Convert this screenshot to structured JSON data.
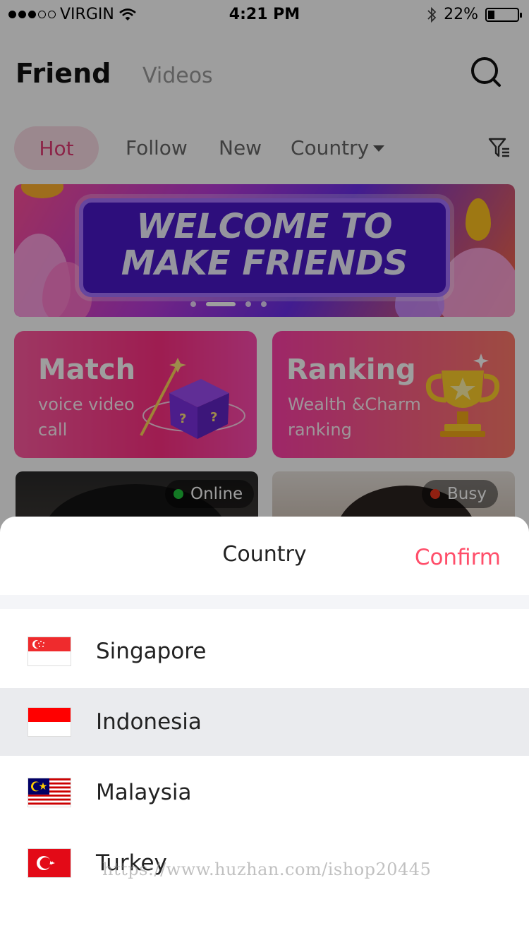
{
  "status_bar": {
    "carrier": "VIRGIN",
    "time": "4:21 PM",
    "battery": "22%",
    "battery_level": 0.22,
    "signal_bars_filled": 3,
    "signal_bars_total": 5
  },
  "header": {
    "title": "Friend",
    "secondary_tab": "Videos",
    "search_icon": "search-icon"
  },
  "filter_tabs": {
    "items": [
      "Hot",
      "Follow",
      "New",
      "Country"
    ],
    "active": "Hot",
    "filter_icon": "filter-icon"
  },
  "banner": {
    "line1": "WELCOME TO",
    "line2": "MAKE FRIENDS",
    "page_count": 4,
    "active_page": 2
  },
  "feature_cards": [
    {
      "title": "Match",
      "subtitle": "voice video call",
      "icon": "magic-box-icon"
    },
    {
      "title": "Ranking",
      "subtitle": "Wealth &Charm ranking",
      "icon": "trophy-icon"
    }
  ],
  "users": [
    {
      "status": "Online",
      "status_color": "#1fc43a"
    },
    {
      "status": "Busy",
      "status_color": "#e8341c"
    }
  ],
  "country_sheet": {
    "title": "Country",
    "confirm": "Confirm",
    "countries": [
      {
        "name": "Singapore",
        "flag": "singapore-flag-icon",
        "selected": false
      },
      {
        "name": "Indonesia",
        "flag": "indonesia-flag-icon",
        "selected": true
      },
      {
        "name": "Malaysia",
        "flag": "malaysia-flag-icon",
        "selected": false
      },
      {
        "name": "Turkey",
        "flag": "turkey-flag-icon",
        "selected": false
      }
    ]
  },
  "colors": {
    "accent_pink": "#e23b75",
    "confirm_red": "#ff4e6a",
    "selected_row_bg": "#eaebee"
  },
  "watermark": "https://www.huzhan.com/ishop20445"
}
